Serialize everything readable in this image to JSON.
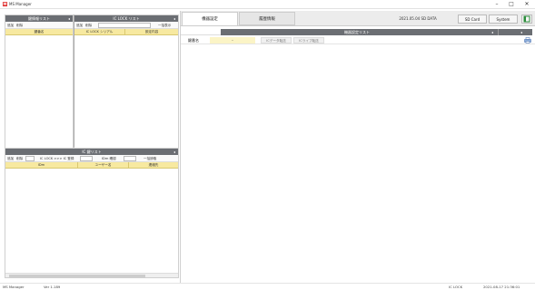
{
  "window": {
    "title": "MS Manager",
    "logo_text": "M",
    "minimize": "–",
    "maximize": "□",
    "close": "✕"
  },
  "left_top": {
    "key_list": {
      "header": "鍵情報リスト",
      "collapse": "◂",
      "toolbar": {
        "add": "追加",
        "delete": "削除"
      },
      "columns": [
        "鍵番名"
      ]
    },
    "iclock_list": {
      "header": "IC LOCK リスト",
      "collapse": "◂",
      "toolbar": {
        "add": "追加",
        "delete": "削除",
        "show_all": "一括表示"
      },
      "columns": [
        "IC LOCK シリアル",
        "設定内容"
      ]
    }
  },
  "left_bottom": {
    "header": "IC 鍵リスト",
    "collapse": "◂",
    "toolbar": {
      "add": "追加",
      "delete": "削除",
      "iclock_to_ic": "IC LOCK >>> IC 登録",
      "idm_confirm": "IDm 確認",
      "register_all": "一括読取"
    },
    "columns": [
      "IDm",
      "ユーザー名",
      "連絡先"
    ]
  },
  "main": {
    "tabs": [
      "機器設定",
      "履歴情報"
    ],
    "active_tab": 0,
    "date_label": "2021.05.04 SD DATA",
    "buttons": {
      "sd_card": "SD Card",
      "system": "System"
    },
    "settings_list_header": "機器設定リスト",
    "settings_list_arrow": "◂",
    "row": {
      "label": "鍵番名",
      "dash": "-",
      "btn_write": "ICデータ転送",
      "btn_read": "ICライブ転送"
    }
  },
  "status": {
    "app": "MS Manager",
    "version": "Ver 1.189",
    "device": "IC LOCK",
    "datetime": "2021-08-17 21:36:01"
  }
}
